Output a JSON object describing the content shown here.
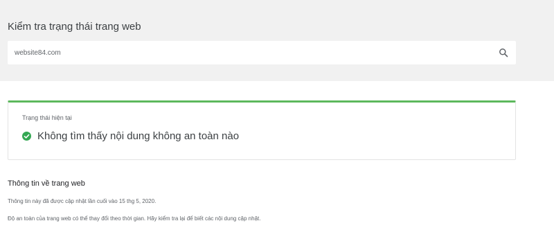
{
  "header": {
    "title": "Kiểm tra trạng thái trang web"
  },
  "search": {
    "value": "website84.com",
    "icon": "search-icon"
  },
  "status_card": {
    "label": "Trạng thái hiện tại",
    "message": "Không tìm thấy nội dung không an toàn nào",
    "icon": "check-circle-icon",
    "accent_color": "#5cb85c"
  },
  "site_info": {
    "heading": "Thông tin về trang web",
    "updated_text": "Thông tin này đã được cập nhật lần cuối vào 15 thg 5, 2020.",
    "note_text": "Độ an toàn của trang web có thể thay đổi theo thời gian. Hãy kiểm tra lại để biết các nội dung cập nhật."
  }
}
